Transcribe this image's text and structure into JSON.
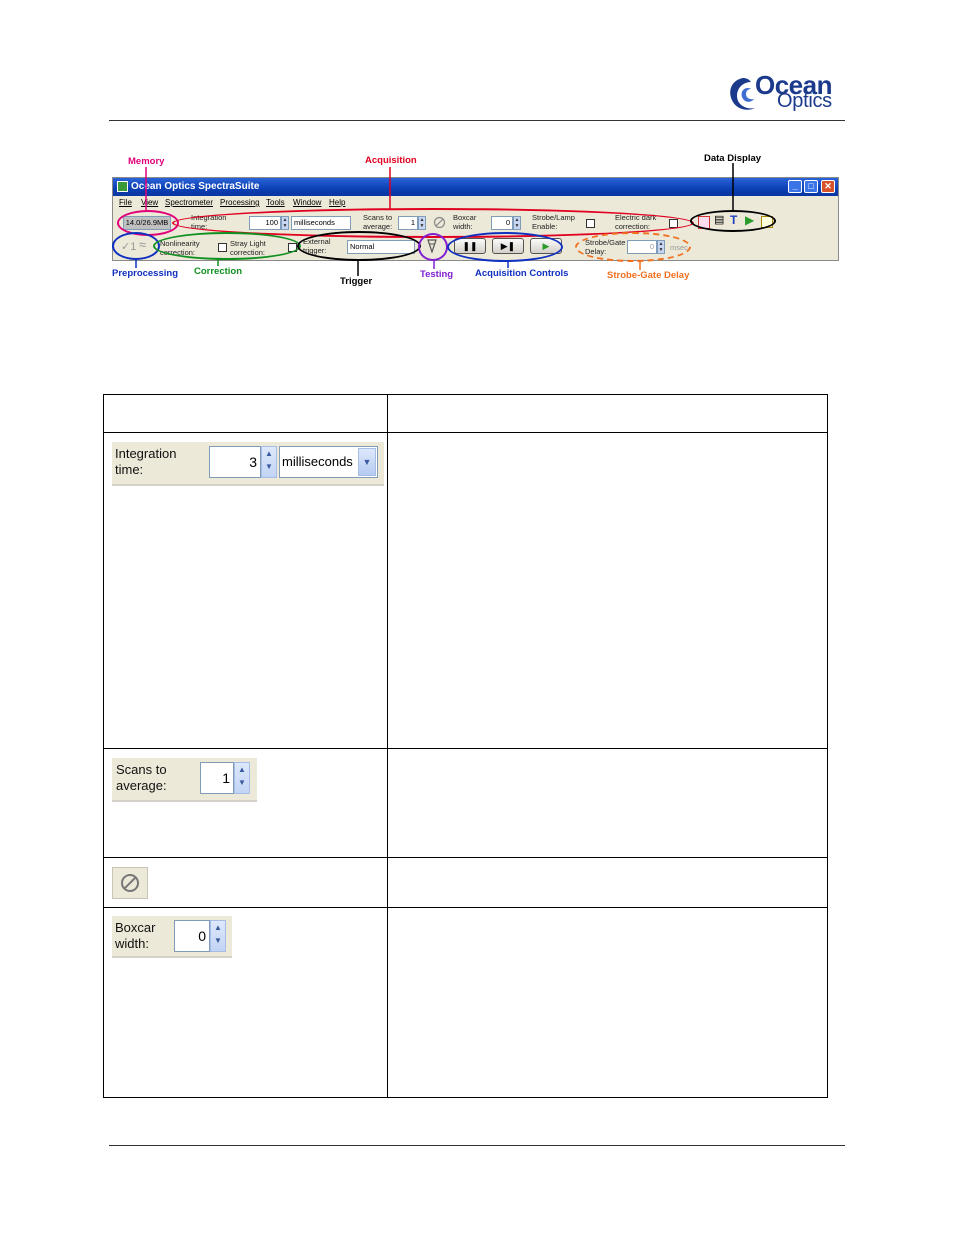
{
  "window": {
    "title": "Ocean Optics SpectraSuite",
    "menu": [
      "File",
      "View",
      "Spectrometer",
      "Processing",
      "Tools",
      "Window",
      "Help"
    ],
    "memory_value": "14.0/26.9MB",
    "integration_label": "Integration time:",
    "integration_value": "100",
    "integration_unit": "milliseconds",
    "scans_label": "Scans to average:",
    "scans_value": "1",
    "boxcar_label": "Boxcar width:",
    "boxcar_value": "0",
    "strobe_label": "Strobe/Lamp Enable:",
    "electric_dark_label": "Electric dark correction:",
    "nonlinearity_label": "Nonlinearity correction:",
    "stray_light_label": "Stray Light correction:",
    "external_trigger_label": "External trigger:",
    "trigger_value": "Normal",
    "strobe_gate_label": "Strobe/Gate Delay:",
    "strobe_gate_value": "0",
    "strobe_gate_unit": "msec",
    "preprocessing_glyph": "≈"
  },
  "annotations": {
    "memory": {
      "label": "Memory",
      "color": "#e0007a"
    },
    "acquisition": {
      "label": "Acquisition",
      "color": "#e00020"
    },
    "data_display": {
      "label": "Data Display",
      "color": "#000000"
    },
    "preprocessing": {
      "label": "Preprocessing",
      "color": "#1030c0"
    },
    "correction": {
      "label": "Correction",
      "color": "#109020"
    },
    "trigger": {
      "label": "Trigger",
      "color": "#000000"
    },
    "testing": {
      "label": "Testing",
      "color": "#8020d0"
    },
    "acquisition_controls": {
      "label": "Acquisition Controls",
      "color": "#1030c0"
    },
    "strobe_gate_delay": {
      "label": "Strobe-Gate Delay",
      "color": "#f07020"
    }
  },
  "table": {
    "row1": {
      "label": "Integration time:",
      "value": "3",
      "unit": "milliseconds"
    },
    "row2": {
      "label": "Scans to average:",
      "value": "1"
    },
    "row3": {
      "icon": "cancel-icon"
    },
    "row4": {
      "label": "Boxcar width:",
      "value": "0"
    }
  }
}
